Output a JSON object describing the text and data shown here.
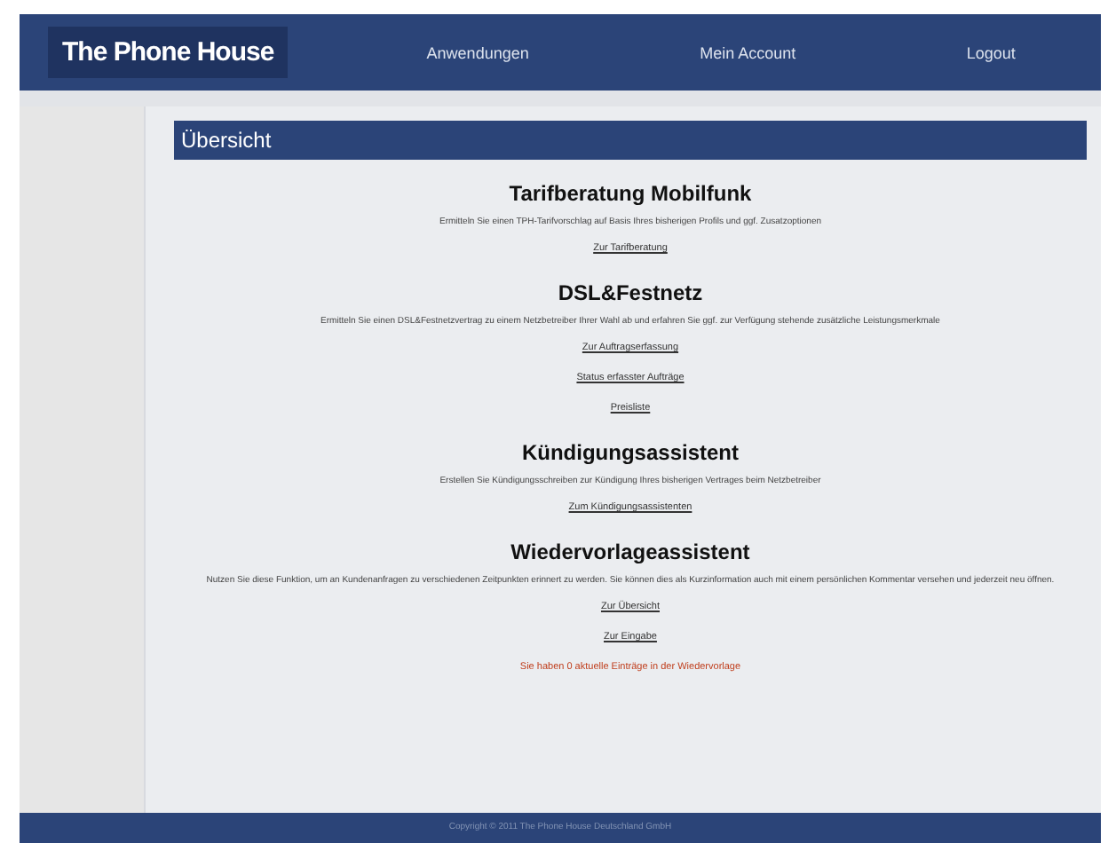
{
  "header": {
    "logo": "The Phone House",
    "nav": [
      {
        "label": "Anwendungen"
      },
      {
        "label": "Mein Account"
      },
      {
        "label": "Logout"
      }
    ]
  },
  "panel_title": "Übersicht",
  "sections": [
    {
      "title": "Tarifberatung Mobilfunk",
      "text": "Ermitteln Sie einen TPH-Tarifvorschlag auf Basis Ihres bisherigen Profils und ggf. Zusatzoptionen",
      "links": [
        {
          "label": "Zur Tarifberatung"
        }
      ]
    },
    {
      "title": "DSL&Festnetz",
      "text": "Ermitteln Sie einen DSL&Festnetzvertrag zu einem Netzbetreiber Ihrer Wahl ab und erfahren Sie ggf. zur Verfügung stehende zusätzliche Leistungsmerkmale",
      "links": [
        {
          "label": "Zur Auftragserfassung"
        },
        {
          "label": "Status erfasster Aufträge"
        },
        {
          "label": "Preisliste"
        }
      ]
    },
    {
      "title": "Kündigungsassistent",
      "text": "Erstellen Sie Kündigungsschreiben zur Kündigung Ihres bisherigen Vertrages beim Netzbetreiber",
      "links": [
        {
          "label": "Zum Kündigungsassistenten"
        }
      ]
    },
    {
      "title": "Wiedervorlageassistent",
      "text": "Nutzen Sie diese Funktion, um an Kundenanfragen zu verschiedenen Zeitpunkten erinnert zu werden. Sie können dies als Kurzinformation auch mit einem persönlichen Kommentar versehen und jederzeit neu öffnen.",
      "links": [
        {
          "label": "Zur Übersicht"
        },
        {
          "label": "Zur Eingabe"
        }
      ],
      "notice": "Sie haben 0 aktuelle Einträge in der Wiedervorlage"
    }
  ],
  "footer": "Copyright © 2011 The Phone House Deutschland GmbH"
}
